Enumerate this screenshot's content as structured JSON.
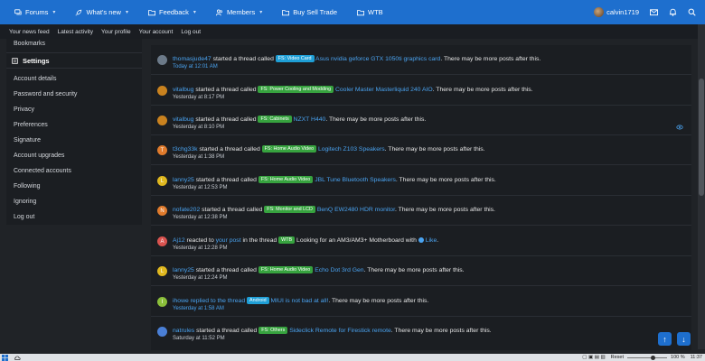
{
  "topnav": {
    "items": [
      {
        "label": "Forums",
        "icon": "chat-bubbles-icon",
        "dropdown": true
      },
      {
        "label": "What's new",
        "icon": "rocket-icon",
        "dropdown": true
      },
      {
        "label": "Feedback",
        "icon": "folder-icon",
        "dropdown": true
      },
      {
        "label": "Members",
        "icon": "users-icon",
        "dropdown": true
      },
      {
        "label": "Buy Sell Trade",
        "icon": "folder-icon",
        "dropdown": false
      },
      {
        "label": "WTB",
        "icon": "folder-icon",
        "dropdown": false
      }
    ],
    "username": "calvin1719",
    "accent": "#1e6fce"
  },
  "subnav": [
    "Your news feed",
    "Latest activity",
    "Your profile",
    "Your account",
    "Log out"
  ],
  "sidebar": {
    "bookmarks": "Bookmarks",
    "settings": "Settings",
    "items": [
      "Account details",
      "Password and security",
      "Privacy",
      "Preferences",
      "Signature",
      "Account upgrades",
      "Connected accounts",
      "Following",
      "Ignoring",
      "Log out"
    ]
  },
  "feed": [
    {
      "user": "thomasjude47",
      "avatar": "",
      "avatar_color": "#6c7a89",
      "action": "started a thread called",
      "prefix": "FS: Video Card",
      "prefix_color": "cyan",
      "title": "Asus nvidia geforce GTX 1050ti graphics card",
      "suffix": ". There may be more posts after this.",
      "time": "Today at 12:01 AM",
      "time_link": true
    },
    {
      "user": "vitalbug",
      "avatar": "",
      "avatar_color": "#c9821f",
      "action": "started a thread called",
      "prefix": "FS: Power Cooling and Modding",
      "prefix_color": "green",
      "title": "Cooler Master Masterliquid 240 AIO",
      "suffix": ". There may be more posts after this.",
      "time": "Yesterday at 8:17 PM",
      "time_link": false
    },
    {
      "user": "vitalbug",
      "avatar": "",
      "avatar_color": "#c9821f",
      "action": "started a thread called",
      "prefix": "FS: Cabinets",
      "prefix_color": "green",
      "title": "NZXT H440",
      "suffix": ". There may be more posts after this.",
      "time": "Yesterday at 8:10 PM",
      "time_link": false
    },
    {
      "user": "t3chg33k",
      "avatar": "T",
      "avatar_color": "#e07b2c",
      "action": "started a thread called",
      "prefix": "FS: Home Audio Video",
      "prefix_color": "green",
      "title": "Logitech Z103 Speakers",
      "suffix": ". There may be more posts after this.",
      "time": "Yesterday at 1:38 PM",
      "time_link": false
    },
    {
      "user": "lanny25",
      "avatar": "L",
      "avatar_color": "#e0b81f",
      "action": "started a thread called",
      "prefix": "FS: Home Audio Video",
      "prefix_color": "green",
      "title": "JBL Tune Bluetooth Speakers",
      "suffix": ". There may be more posts after this.",
      "time": "Yesterday at 12:53 PM",
      "time_link": false
    },
    {
      "user": "nofate202",
      "avatar": "N",
      "avatar_color": "#e07b2c",
      "action": "started a thread called",
      "prefix": "FS: Monitor and LCD",
      "prefix_color": "green",
      "title": "BenQ EW2480 HDR monitor",
      "suffix": ". There may be more posts after this.",
      "time": "Yesterday at 12:38 PM",
      "time_link": false
    },
    {
      "user": "Aj12",
      "avatar": "A",
      "avatar_color": "#d9534f",
      "action": "reacted to",
      "post_link": "your post",
      "mid": "in the thread",
      "prefix": "WTB",
      "prefix_color": "green",
      "title": "Looking for an AM3/AM3+ Motherboard with",
      "reaction": "Like",
      "suffix": ".",
      "time": "Yesterday at 12:28 PM",
      "time_link": false,
      "type": "reaction"
    },
    {
      "user": "lanny25",
      "avatar": "L",
      "avatar_color": "#e0b81f",
      "action": "started a thread called",
      "prefix": "FS: Home Audio Video",
      "prefix_color": "green",
      "title": "Echo Dot 3rd Gen",
      "suffix": ". There may be more posts after this.",
      "time": "Yesterday at 12:24 PM",
      "time_link": false
    },
    {
      "user": "ihowe",
      "avatar": "I",
      "avatar_color": "#8bbf3a",
      "action": "replied to the thread",
      "prefix": "Android",
      "prefix_color": "cyan",
      "title": "MIUI is not bad at all!",
      "suffix": ". There may be more posts after this.",
      "time": "Yesterday at 1:58 AM",
      "time_link": true,
      "type": "reply"
    },
    {
      "user": "natrules",
      "avatar": "",
      "avatar_color": "#4a7fd6",
      "action": "started a thread called",
      "prefix": "FS: Others",
      "prefix_color": "green",
      "title": "Sideclick Remote for Firestick remote",
      "suffix": ". There may be more posts after this.",
      "time": "Saturday at 11:52 PM",
      "time_link": false
    }
  ],
  "taskbar": {
    "reset": "Reset",
    "zoom": "100 %",
    "zoom_level": 0.6,
    "clock": "11:37"
  }
}
